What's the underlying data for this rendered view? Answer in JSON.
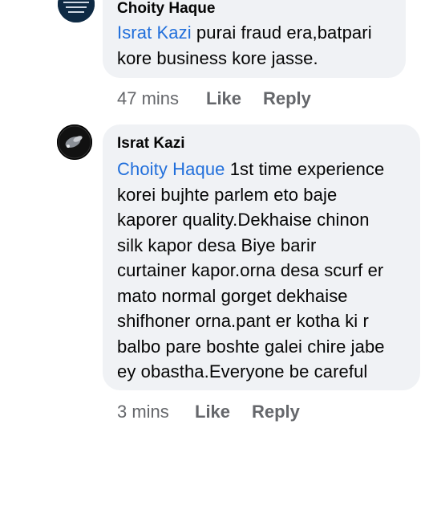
{
  "comments": [
    {
      "author": "Choity Haque",
      "mention": "Israt Kazi",
      "text_line1_rest": " purai fraud era,batpari",
      "text_rest_lines": [
        "kore business kore jasse."
      ],
      "time": "47 mins",
      "like_label": "Like",
      "reply_label": "Reply"
    },
    {
      "author": "Israt Kazi",
      "mention": "Choity Haque",
      "text_line1_rest": " 1st time experience",
      "text_rest_lines": [
        "korei bujhte parlem eto baje",
        "kaporer quality.Dekhaise chinon",
        "silk kapor desa Biye barir",
        "curtainer kapor.orna desa scurf er",
        "mato normal gorget dekhaise",
        "shifhoner orna.pant er kotha ki r",
        "balbo pare boshte galei chire jabe",
        "ey obastha.Everyone be careful"
      ],
      "time": "3 mins",
      "like_label": "Like",
      "reply_label": "Reply"
    }
  ],
  "colors": {
    "bubble": "#f0f2f5",
    "mention": "#216fdb",
    "meta": "#65676b"
  }
}
